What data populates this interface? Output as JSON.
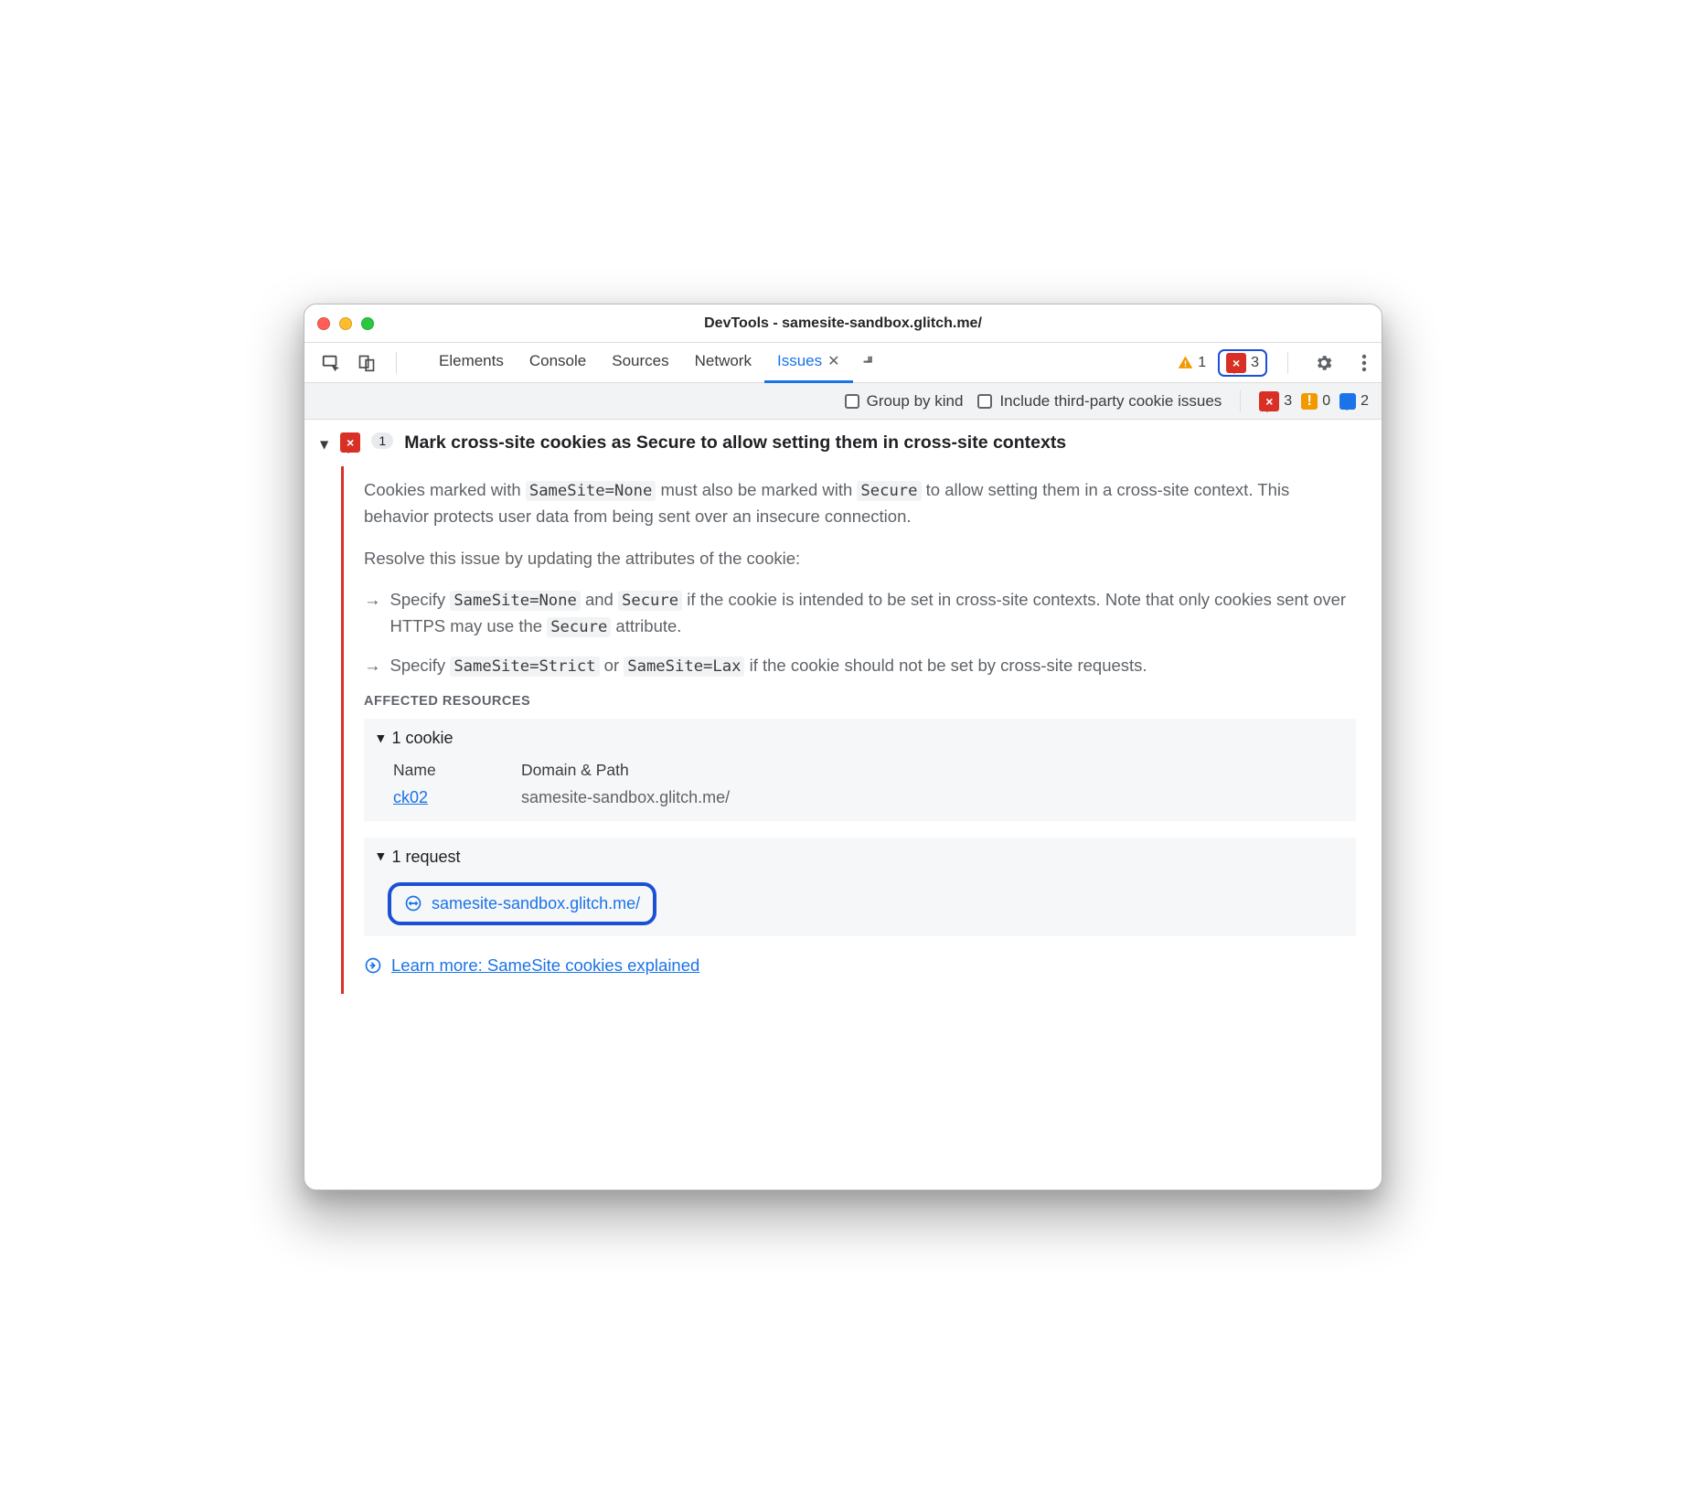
{
  "window": {
    "title": "DevTools - samesite-sandbox.glitch.me/"
  },
  "toolbar": {
    "tabs": [
      "Elements",
      "Console",
      "Sources",
      "Network",
      "Issues"
    ],
    "active_tab_index": 4,
    "warning_count": "1",
    "error_count": "3"
  },
  "filterbar": {
    "group_by_kind": "Group by kind",
    "third_party": "Include third-party cookie issues",
    "counts": {
      "errors": "3",
      "warnings": "0",
      "messages": "2"
    }
  },
  "issue": {
    "count": "1",
    "title": "Mark cross-site cookies as Secure to allow setting them in cross-site contexts",
    "desc_1a": "Cookies marked with ",
    "desc_1code1": "SameSite=None",
    "desc_1b": " must also be marked with ",
    "desc_1code2": "Secure",
    "desc_1c": " to allow setting them in a cross-site context. This behavior protects user data from being sent over an insecure connection.",
    "desc_2": "Resolve this issue by updating the attributes of the cookie:",
    "b1a": "Specify ",
    "b1code1": "SameSite=None",
    "b1b": " and ",
    "b1code2": "Secure",
    "b1c": " if the cookie is intended to be set in cross-site contexts. Note that only cookies sent over HTTPS may use the ",
    "b1code3": "Secure",
    "b1d": " attribute.",
    "b2a": "Specify ",
    "b2code1": "SameSite=Strict",
    "b2b": " or ",
    "b2code2": "SameSite=Lax",
    "b2c": " if the cookie should not be set by cross-site requests.",
    "affected_h": "AFFECTED RESOURCES",
    "cookie_h": "1 cookie",
    "cookie_cols": {
      "name": "Name",
      "domain": "Domain & Path"
    },
    "cookie_row": {
      "name": "ck02",
      "domain": "samesite-sandbox.glitch.me/"
    },
    "request_h": "1 request",
    "request_url": "samesite-sandbox.glitch.me/",
    "learn": "Learn more: SameSite cookies explained"
  }
}
